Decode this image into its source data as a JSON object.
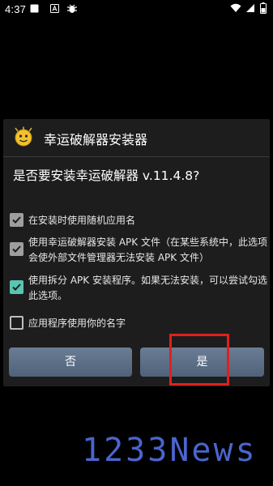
{
  "status_bar": {
    "time": "4:37",
    "left_icons": [
      "square-icon",
      "a-icon",
      "bug-icon"
    ],
    "right_icons": [
      "wifi-icon",
      "signal-icon",
      "battery-icon"
    ]
  },
  "dialog": {
    "title": "幸运破解器安装器",
    "question": "是否要安装幸运破解器 v.11.4.8?",
    "options": [
      {
        "label": "在安装时使用随机应用名",
        "checked": true
      },
      {
        "label": "使用幸运破解器安装 APK 文件（在某些系统中，此选项会使外部文件管理器无法安装 APK 文件）",
        "checked": true
      },
      {
        "label": "使用拆分 APK 安装程序。如果无法安装，可以尝试勾选此选项。",
        "checked": true
      },
      {
        "label": "应用程序使用你的名字",
        "checked": false
      }
    ],
    "buttons": {
      "no": "否",
      "yes": "是"
    }
  },
  "colors": {
    "dialog_bg": "#1d1d1d",
    "button_bg": "#5c6f87",
    "checkbox_gray": "#9e9e9e",
    "checkbox_accent": "#5ac4b2",
    "highlight": "#e0201d",
    "watermark": "#4f6bd8"
  },
  "watermark": {
    "text": "1233News"
  }
}
